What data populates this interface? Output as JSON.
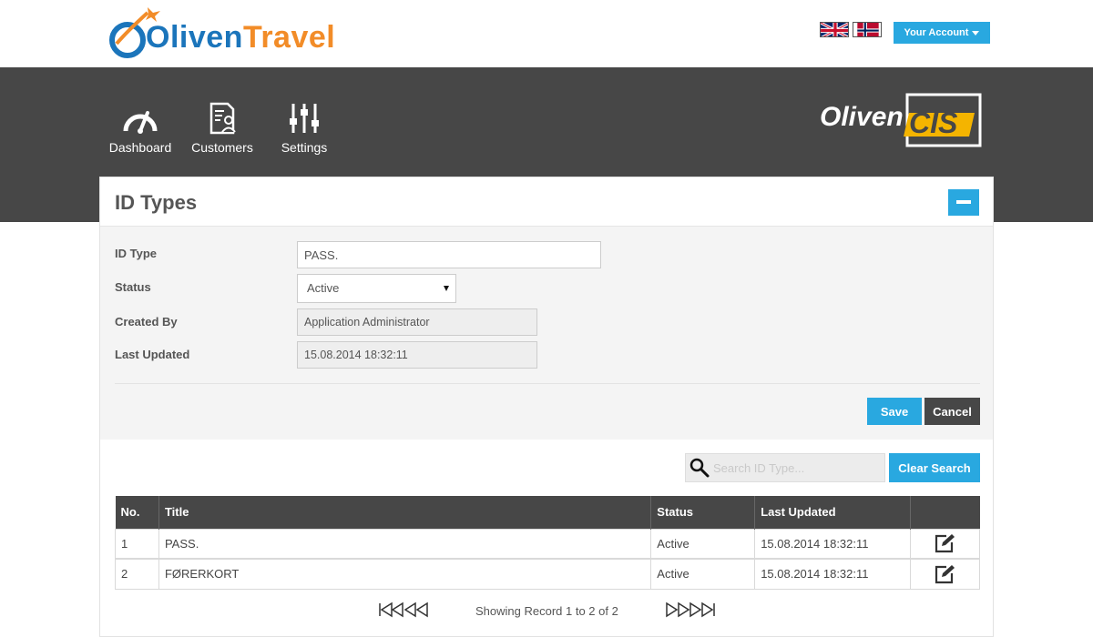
{
  "brand": {
    "logo_part1": "Oliven",
    "logo_part2": "Travel",
    "cis_logo_part1": "Oliven",
    "cis_logo_part2": "CIS"
  },
  "header": {
    "account_label": "Your Account",
    "languages": [
      "uk-flag-icon",
      "norway-flag-icon"
    ]
  },
  "nav": {
    "items": [
      {
        "label": "Dashboard",
        "icon": "gauge-icon"
      },
      {
        "label": "Customers",
        "icon": "customer-form-icon"
      },
      {
        "label": "Settings",
        "icon": "sliders-icon"
      }
    ]
  },
  "panel": {
    "title": "ID Types",
    "form": {
      "id_type_label": "ID Type",
      "id_type_value": "PASS.",
      "status_label": "Status",
      "status_value": "Active",
      "created_by_label": "Created By",
      "created_by_value": "Application Administrator",
      "last_updated_label": "Last Updated",
      "last_updated_value": "15.08.2014 18:32:11"
    },
    "save_label": "Save",
    "cancel_label": "Cancel"
  },
  "search": {
    "placeholder": "Search ID Type...",
    "clear_label": "Clear Search"
  },
  "table": {
    "headers": {
      "no": "No.",
      "title": "Title",
      "status": "Status",
      "last_updated": "Last Updated"
    },
    "rows": [
      {
        "no": "1",
        "title": "PASS.",
        "status": "Active",
        "last_updated": "15.08.2014 18:32:11"
      },
      {
        "no": "2",
        "title": "FØRERKORT",
        "status": "Active",
        "last_updated": "15.08.2014 18:32:11"
      }
    ]
  },
  "pager": {
    "text": "Showing Record 1 to 2 of 2"
  },
  "colors": {
    "accent": "#29a8e0",
    "dark": "#474747",
    "logo_blue": "#1b75bb",
    "logo_orange": "#f28c28",
    "cis_yellow": "#f4b400"
  }
}
